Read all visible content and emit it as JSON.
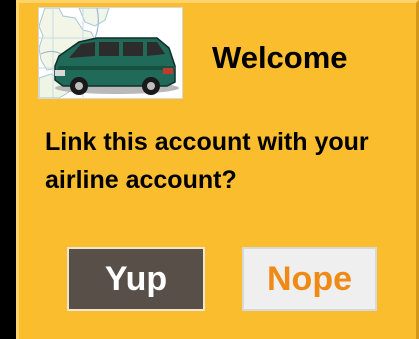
{
  "dialog": {
    "title": "Welcome",
    "question": "Link this account with your airline account?",
    "buttons": {
      "yes_label": "Yup",
      "no_label": "Nope"
    }
  },
  "logo": {
    "icon": "van-on-map-icon"
  },
  "colors": {
    "background": "#f9bd2e",
    "yes_button_bg": "#585048",
    "yes_button_text": "#ffffff",
    "no_button_bg": "#efefef",
    "no_button_text": "#f08a16",
    "van_body": "#1f6a58"
  }
}
